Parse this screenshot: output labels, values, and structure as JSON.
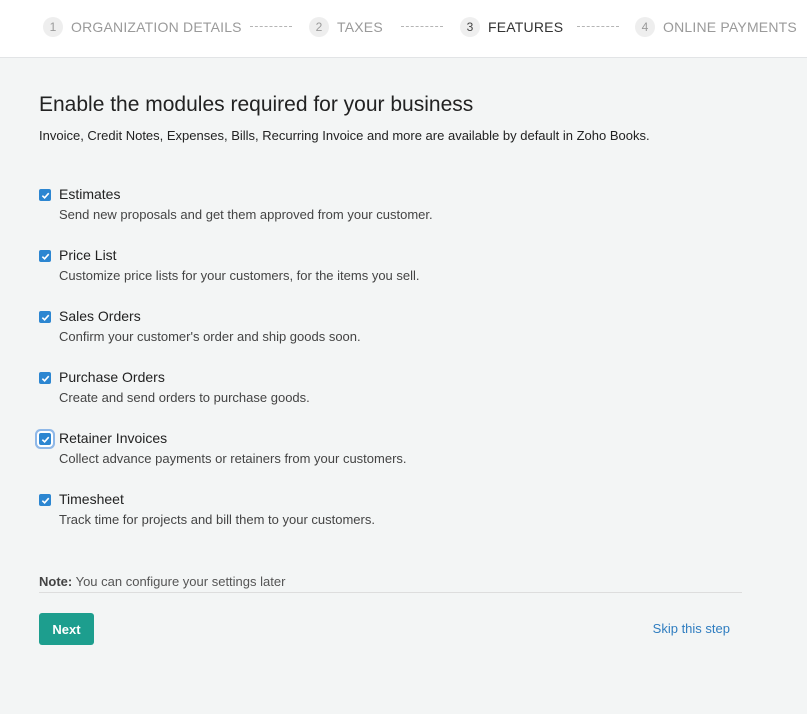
{
  "stepper": {
    "steps": [
      {
        "number": "1",
        "label": "ORGANIZATION DETAILS"
      },
      {
        "number": "2",
        "label": "TAXES"
      },
      {
        "number": "3",
        "label": "FEATURES"
      },
      {
        "number": "4",
        "label": "ONLINE PAYMENTS"
      }
    ],
    "active_step": "3"
  },
  "page": {
    "heading": "Enable the modules required for your business",
    "subheading": "Invoice, Credit Notes, Expenses, Bills, Recurring Invoice and more are available by default in Zoho Books."
  },
  "features": [
    {
      "title": "Estimates",
      "description": "Send new proposals and get them approved from your customer.",
      "checked": true
    },
    {
      "title": "Price List",
      "description": "Customize price lists for your customers, for the items you sell.",
      "checked": true
    },
    {
      "title": "Sales Orders",
      "description": "Confirm your customer's order and ship goods soon.",
      "checked": true
    },
    {
      "title": "Purchase Orders",
      "description": "Create and send orders to purchase goods.",
      "checked": true
    },
    {
      "title": "Retainer Invoices",
      "description": "Collect advance payments or retainers from your customers.",
      "checked": true
    },
    {
      "title": "Timesheet",
      "description": "Track time for projects and bill them to your customers.",
      "checked": true
    }
  ],
  "note": {
    "label": "Note:",
    "text": " You can configure your settings later"
  },
  "actions": {
    "next_label": "Next",
    "skip_label": "Skip this step"
  },
  "colors": {
    "primary_button": "#1d9e8e",
    "link": "#2f7dc0",
    "checkbox": "#2c86d1",
    "background": "#f3f5f5"
  }
}
